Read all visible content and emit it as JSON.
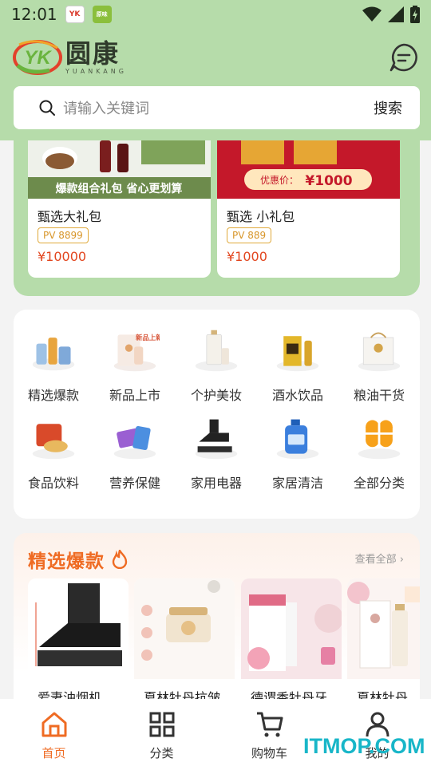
{
  "status_bar": {
    "time": "12:01",
    "app_icons": [
      "YK",
      "原味"
    ]
  },
  "brand": {
    "logo_text": "YK",
    "name": "圆康",
    "sub": "YUANKANG"
  },
  "search": {
    "placeholder": "请输入关键词",
    "action": "搜索"
  },
  "gift_packs": [
    {
      "image_caption": "爆款组合礼包  省心更划算",
      "title": "甄选大礼包",
      "pv": "PV 8899",
      "price": "¥10000"
    },
    {
      "image_caption": "优惠价：",
      "image_price": "¥1000",
      "title": "甄选 小礼包",
      "pv": "PV 889",
      "price": "¥1000"
    }
  ],
  "categories": [
    {
      "label": "精选爆款",
      "icon": "cosmetics-set-icon"
    },
    {
      "label": "新品上市",
      "icon": "new-product-icon",
      "icon_text": "新品上新"
    },
    {
      "label": "个护美妆",
      "icon": "lotion-bottle-icon"
    },
    {
      "label": "酒水饮品",
      "icon": "liquor-box-icon"
    },
    {
      "label": "粮油干货",
      "icon": "grain-gift-bag-icon"
    },
    {
      "label": "食品饮料",
      "icon": "snack-bag-icon"
    },
    {
      "label": "营养保健",
      "icon": "supplement-icon"
    },
    {
      "label": "家用电器",
      "icon": "range-hood-icon"
    },
    {
      "label": "家居清洁",
      "icon": "detergent-bottle-icon"
    },
    {
      "label": "全部分类",
      "icon": "all-categories-icon"
    }
  ],
  "featured": {
    "title": "精选爆款",
    "more": "查看全部 ›",
    "items": [
      {
        "name": "爱妻油烟机"
      },
      {
        "name": "夏林牡丹抗皱"
      },
      {
        "name": "德谓香牡丹牙"
      },
      {
        "name": "夏林牡丹"
      }
    ]
  },
  "bottom_nav": [
    {
      "label": "首页",
      "icon": "home-icon",
      "active": true
    },
    {
      "label": "分类",
      "icon": "grid-icon",
      "active": false
    },
    {
      "label": "购物车",
      "icon": "cart-icon",
      "active": false
    },
    {
      "label": "我的",
      "icon": "user-icon",
      "active": false
    }
  ],
  "watermark": "ITMOP.COM",
  "colors": {
    "brand_green": "#b6dcaa",
    "accent_orange": "#ef6b23",
    "price_red": "#e2461f",
    "pv_gold": "#d8962a"
  }
}
